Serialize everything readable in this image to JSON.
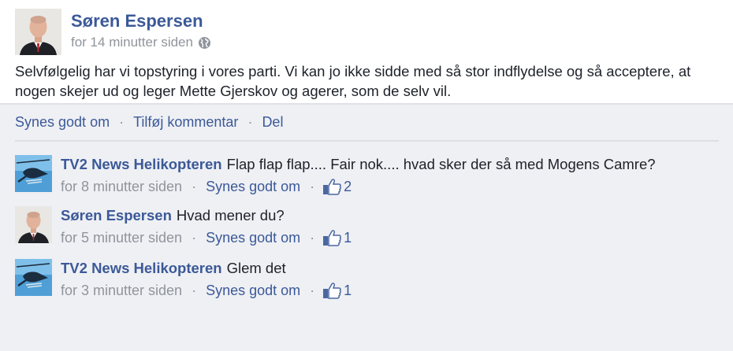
{
  "post": {
    "author": "Søren Espersen",
    "timestamp": "for 14 minutter siden",
    "privacy_icon": "globe-icon",
    "text": "Selvfølgelig har vi topstyring i vores parti. Vi kan jo ikke sidde med så stor indflydelse og så acceptere, at nogen skejer ud og leger Mette Gjerskov og agerer, som de selv vil.",
    "actions": {
      "like": "Synes godt om",
      "separator": "·",
      "comment": "Tilføj kommentar",
      "share": "Del"
    }
  },
  "comments": [
    {
      "author": "TV2 News Helikopteren",
      "text": "Flap flap flap....  Fair nok.... hvad sker der så med Mogens Camre?",
      "timestamp": "for 8 minutter siden",
      "like_label": "Synes godt om",
      "like_count": "2",
      "avatar": "helicopter-avatar"
    },
    {
      "author": "Søren Espersen",
      "text": "Hvad mener du?",
      "timestamp": "for 5 minutter siden",
      "like_label": "Synes godt om",
      "like_count": "1",
      "avatar": "person-avatar"
    },
    {
      "author": "TV2 News Helikopteren",
      "text": "Glem det",
      "timestamp": "for 3 minutter siden",
      "like_label": "Synes godt om",
      "like_count": "1",
      "avatar": "helicopter-avatar"
    }
  ],
  "colors": {
    "link": "#3b5998",
    "muted": "#90949c",
    "background": "#eff0f4"
  }
}
